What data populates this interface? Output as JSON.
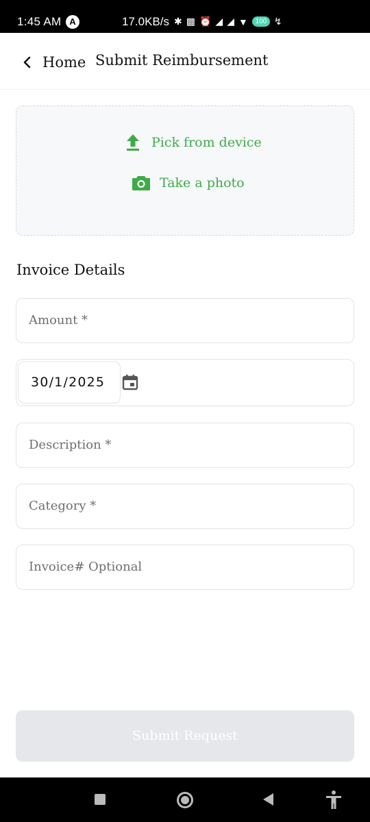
{
  "status_bar": {
    "time": "1:45 AM",
    "nav_badge": "A",
    "speed": "17.0KB/s",
    "icons": [
      "bluetooth-icon",
      "vibrate-icon",
      "alarm-icon",
      "signal-icon",
      "signal-icon",
      "wifi-icon"
    ],
    "battery": "100"
  },
  "header": {
    "back_label": "Home",
    "title": "Submit Reimbursement"
  },
  "upload": {
    "pick_label": "Pick from device",
    "photo_label": "Take a photo"
  },
  "section_title": "Invoice Details",
  "fields": {
    "amount_placeholder": "Amount *",
    "date_value": "30/1/2025",
    "description_placeholder": "Description *",
    "category_placeholder": "Category *",
    "invoice_placeholder": "Invoice# Optional"
  },
  "submit_label": "Submit Request",
  "colors": {
    "accent_green": "#3fab48",
    "disabled_button": "#e5e7eb",
    "upload_bg": "#f6f8fa",
    "battery": "#4ed6b6"
  }
}
